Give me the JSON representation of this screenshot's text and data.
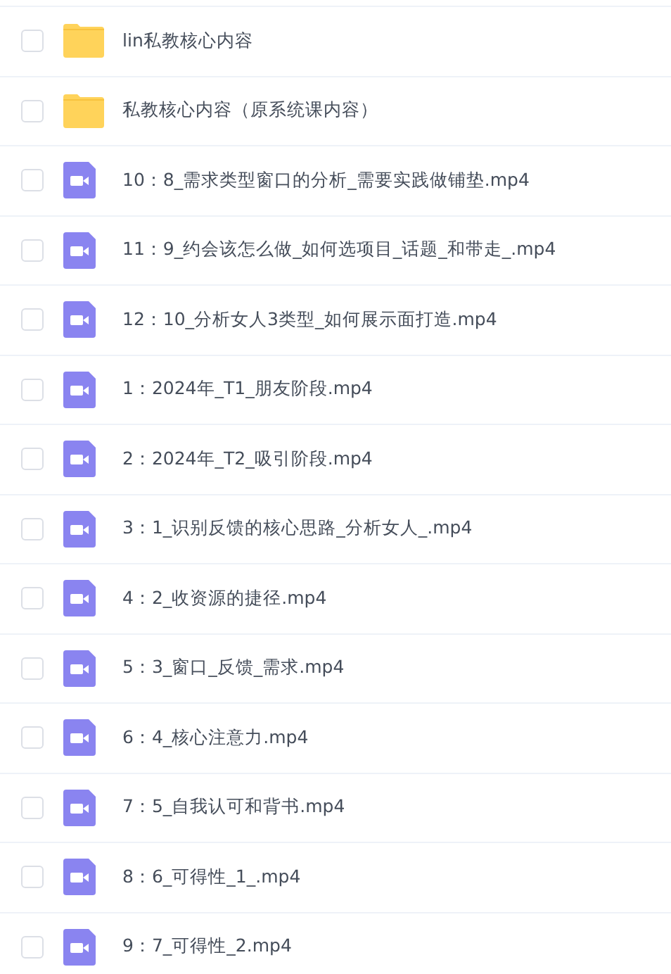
{
  "files": [
    {
      "kind": "folder",
      "name": "lin私教核心内容",
      "checked": false
    },
    {
      "kind": "folder",
      "name": "私教核心内容（原系统课内容）",
      "checked": false
    },
    {
      "kind": "video",
      "name": "10：8_需求类型窗口的分析_需要实践做铺垫.mp4",
      "checked": false
    },
    {
      "kind": "video",
      "name": "11：9_约会该怎么做_如何选项目_话题_和带走_.mp4",
      "checked": false
    },
    {
      "kind": "video",
      "name": "12：10_分析女人3类型_如何展示面打造.mp4",
      "checked": false
    },
    {
      "kind": "video",
      "name": "1：2024年_T1_朋友阶段.mp4",
      "checked": false
    },
    {
      "kind": "video",
      "name": "2：2024年_T2_吸引阶段.mp4",
      "checked": false
    },
    {
      "kind": "video",
      "name": "3：1_识别反馈的核心思路_分析女人_.mp4",
      "checked": false
    },
    {
      "kind": "video",
      "name": "4：2_收资源的捷径.mp4",
      "checked": false
    },
    {
      "kind": "video",
      "name": "5：3_窗口_反馈_需求.mp4",
      "checked": false
    },
    {
      "kind": "video",
      "name": "6：4_核心注意力.mp4",
      "checked": false
    },
    {
      "kind": "video",
      "name": "7：5_自我认可和背书.mp4",
      "checked": false
    },
    {
      "kind": "video",
      "name": "8：6_可得性_1_.mp4",
      "checked": false
    },
    {
      "kind": "video",
      "name": "9：7_可得性_2.mp4",
      "checked": false
    }
  ]
}
